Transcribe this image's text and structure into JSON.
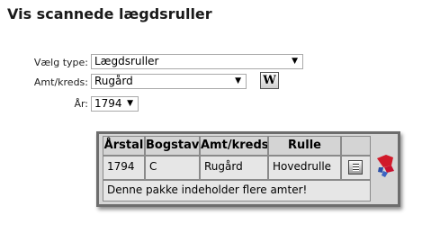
{
  "page": {
    "title": "Vis scannede lægdsruller"
  },
  "form": {
    "type_label": "Vælg type:",
    "type_value": "Lægdsruller",
    "district_label": "Amt/kreds:",
    "district_value": "Rugård",
    "year_label": "År:",
    "year_value": "1794",
    "dropdown_arrow": "▼",
    "wiki_button_glyph": "W"
  },
  "table": {
    "headers": [
      "Årstal",
      "Bogstav",
      "Amt/kreds",
      "Rulle"
    ],
    "row": {
      "year": "1794",
      "letter": "C",
      "district": "Rugård",
      "roll": "Hovedrulle"
    },
    "note": "Denne pakke indeholder flere amter!"
  },
  "icons": {
    "wiki": "wikipedia-icon",
    "notes": "document-notes-icon",
    "map": "map-puzzle-icon"
  },
  "colors": {
    "frame_border": "#6d6d6d",
    "frame_background": "#d6d6d6",
    "map_red": "#d11a2a",
    "map_blue": "#2a4fa8"
  }
}
